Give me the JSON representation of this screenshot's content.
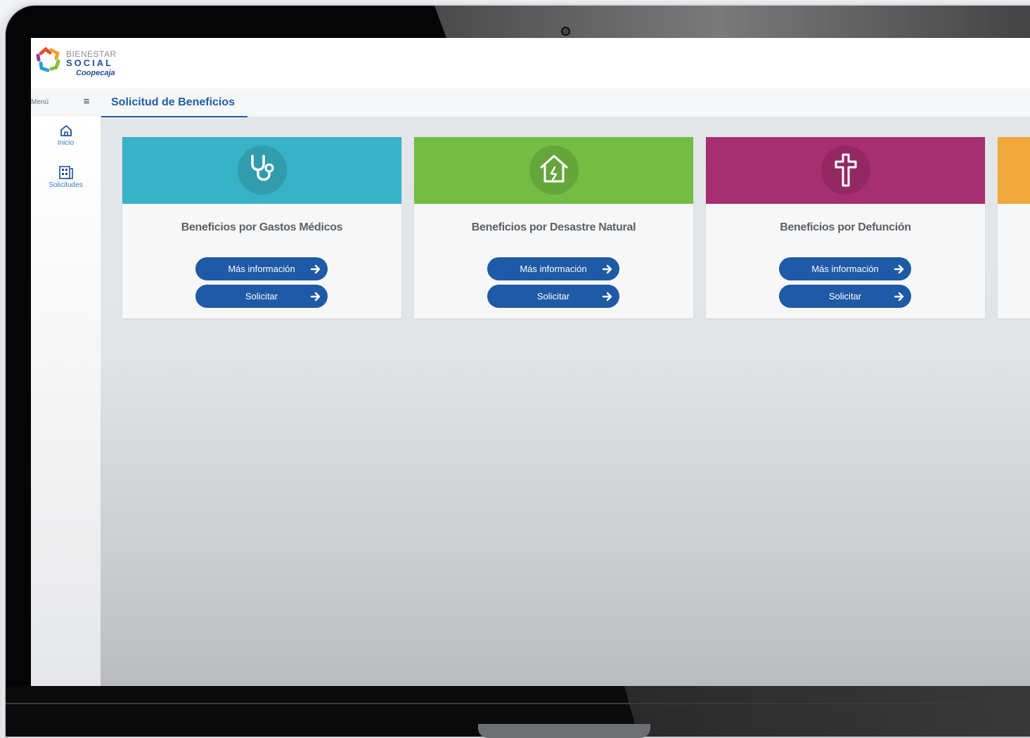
{
  "logo": {
    "line1": "BIENESTAR",
    "line2": "SOCIAL",
    "line3": "Coopecaja"
  },
  "nav": {
    "menu_label": "Menú",
    "active_tab": "Solicitud de Beneficios"
  },
  "sidebar": {
    "items": [
      {
        "label": "Inicio",
        "icon": "home-icon"
      },
      {
        "label": "Solicitudes",
        "icon": "requests-icon"
      }
    ]
  },
  "cards": [
    {
      "title": "Beneficios por Gastos Médicos",
      "color": "#37b2c7",
      "icon": "stethoscope-icon",
      "info_label": "Más información",
      "request_label": "Solicitar"
    },
    {
      "title": "Beneficios por Desastre Natural",
      "color": "#73bd44",
      "icon": "damaged-house-icon",
      "info_label": "Más información",
      "request_label": "Solicitar"
    },
    {
      "title": "Beneficios por Defunción",
      "color": "#a82e72",
      "icon": "cross-icon",
      "info_label": "Más información",
      "request_label": "Solicitar"
    },
    {
      "title": "",
      "color": "#f0a93a",
      "icon": "",
      "info_label": "",
      "request_label": ""
    }
  ],
  "colors": {
    "primary": "#1e5aa6",
    "tab_active": "#1f5fa8",
    "card_title": "#5c6066"
  }
}
